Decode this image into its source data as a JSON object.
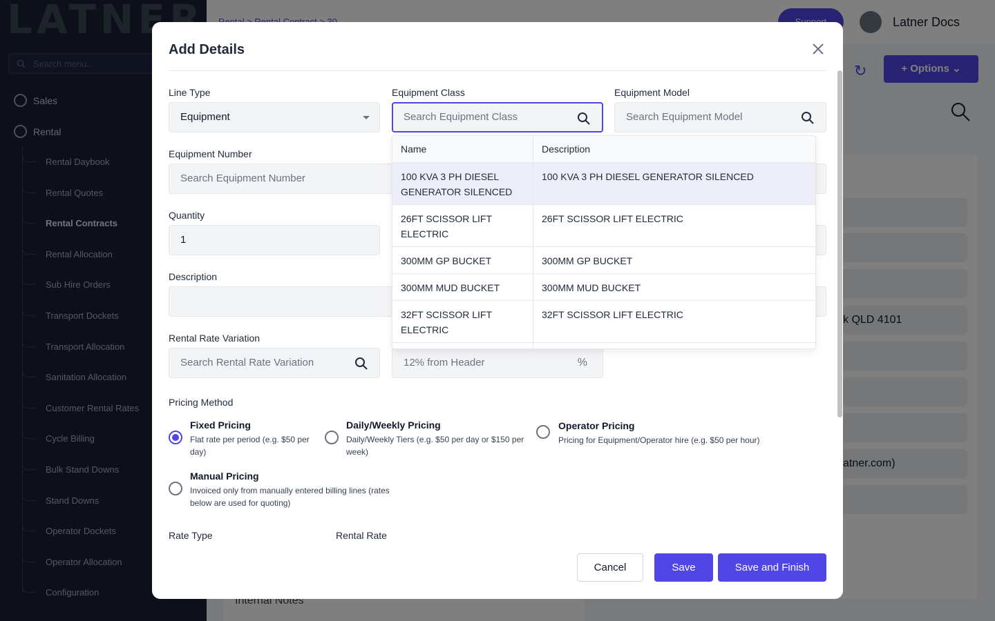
{
  "background": {
    "logo_text": "LATNER",
    "side_search_placeholder": "Search menu...",
    "nav_top": [
      {
        "label": "Sales",
        "icon": "settings-icon"
      },
      {
        "label": "Rental",
        "icon": "face-icon"
      }
    ],
    "nav_sub": [
      {
        "label": "Rental Daybook"
      },
      {
        "label": "Rental Quotes"
      },
      {
        "label": "Rental Contracts",
        "active": true
      },
      {
        "label": "Rental Allocation"
      },
      {
        "label": "Sub Hire Orders"
      },
      {
        "label": "Transport Dockets"
      },
      {
        "label": "Transport Allocation"
      },
      {
        "label": "Sanitation Allocation"
      },
      {
        "label": "Customer Rental Rates"
      },
      {
        "label": "Cycle Billing"
      },
      {
        "label": "Bulk Stand Downs"
      },
      {
        "label": "Stand Downs"
      },
      {
        "label": "Operator Dockets"
      },
      {
        "label": "Operator Allocation"
      },
      {
        "label": "Configuration"
      }
    ],
    "breadcrumb": "Rental  >  Rental Contract  >  30",
    "support_label": "Support",
    "user_name": "Latner Docs",
    "options_label": "Options",
    "fragment_address": "k QLD 4101",
    "fragment_email": "atner.com)",
    "internal_notes": "Internal Notes"
  },
  "modal": {
    "title": "Add Details",
    "line_type": {
      "label": "Line Type",
      "value": "Equipment"
    },
    "equipment_class": {
      "label": "Equipment Class",
      "placeholder": "Search Equipment Class"
    },
    "equipment_model": {
      "label": "Equipment Model",
      "placeholder": "Search Equipment Model"
    },
    "equipment_number": {
      "label": "Equipment Number",
      "placeholder": "Search Equipment Number"
    },
    "quantity": {
      "label": "Quantity",
      "value": "1"
    },
    "description": {
      "label": "Description",
      "value": ""
    },
    "rental_rate_variation": {
      "label": "Rental Rate Variation",
      "placeholder": "Search Rental Rate Variation"
    },
    "header_percent": {
      "placeholder": "12% from Header",
      "suffix": "%"
    },
    "pricing_method": {
      "label": "Pricing Method",
      "selected": "Fixed Pricing",
      "options": [
        {
          "title": "Fixed Pricing",
          "desc": "Flat rate per period (e.g. $50 per day)"
        },
        {
          "title": "Daily/Weekly Pricing",
          "desc": "Daily/Weekly Tiers (e.g. $50 per day or $150 per week)"
        },
        {
          "title": "Operator Pricing",
          "desc": "Pricing for Equipment/Operator hire (e.g. $50 per hour)"
        },
        {
          "title": "Manual Pricing",
          "desc": "Invoiced only from manually entered billing lines (rates below are used for quoting)"
        }
      ]
    },
    "rate_type_label": "Rate Type",
    "rental_rate_label": "Rental Rate",
    "buttons": {
      "cancel": "Cancel",
      "save": "Save",
      "save_finish": "Save and Finish"
    }
  },
  "dropdown": {
    "columns": [
      "Name",
      "Description"
    ],
    "rows": [
      {
        "name": "100 KVA 3 PH DIESEL GENERATOR SILENCED",
        "description": "100 KVA 3 PH DIESEL GENERATOR SILENCED",
        "highlighted": true
      },
      {
        "name": "26FT SCISSOR LIFT ELECTRIC",
        "description": "26FT SCISSOR LIFT ELECTRIC"
      },
      {
        "name": "300MM GP BUCKET",
        "description": "300MM GP BUCKET"
      },
      {
        "name": "300MM MUD BUCKET",
        "description": "300MM MUD BUCKET"
      },
      {
        "name": "32FT SCISSOR LIFT ELECTRIC",
        "description": "32FT SCISSOR LIFT ELECTRIC"
      }
    ]
  },
  "colors": {
    "accent": "#4f46e5",
    "sidebar": "#1a1f36",
    "highlight_row": "#eeeefb"
  }
}
